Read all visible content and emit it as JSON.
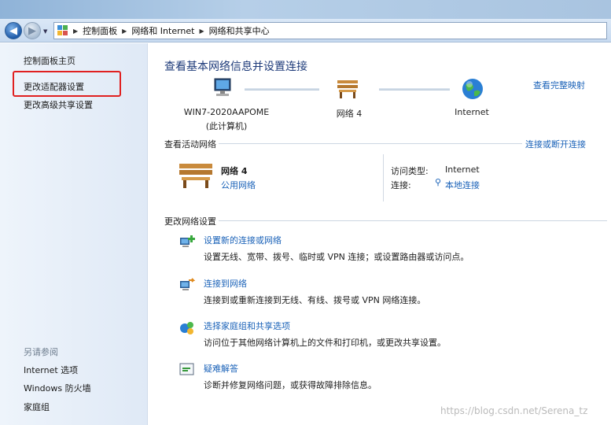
{
  "address_bar": {
    "breadcrumbs": [
      "控制面板",
      "网络和 Internet",
      "网络和共享中心"
    ]
  },
  "sidebar": {
    "home": "控制面板主页",
    "change_adapter": "更改适配器设置",
    "advanced_sharing": "更改高级共享设置",
    "see_also_title": "另请参阅",
    "see_also": [
      "Internet 选项",
      "Windows 防火墙",
      "家庭组"
    ]
  },
  "main": {
    "title": "查看基本网络信息并设置连接",
    "view_full_map": "查看完整映射",
    "map": {
      "computer_name": "WIN7-2020AAPOME",
      "computer_sub": "(此计算机)",
      "network": "网络  4",
      "internet": "Internet"
    },
    "active_header": "查看活动网络",
    "connect_disconnect": "连接或断开连接",
    "active_network": {
      "name": "网络  4",
      "type": "公用网络",
      "access_type_label": "访问类型:",
      "access_type_value": "Internet",
      "connection_label": "连接:",
      "connection_value": "本地连接"
    },
    "change_header": "更改网络设置",
    "tasks": [
      {
        "title": "设置新的连接或网络",
        "desc": "设置无线、宽带、拨号、临时或 VPN 连接；或设置路由器或访问点。"
      },
      {
        "title": "连接到网络",
        "desc": "连接到或重新连接到无线、有线、拨号或 VPN 网络连接。"
      },
      {
        "title": "选择家庭组和共享选项",
        "desc": "访问位于其他网络计算机上的文件和打印机，或更改共享设置。"
      },
      {
        "title": "疑难解答",
        "desc": "诊断并修复网络问题，或获得故障排除信息。"
      }
    ]
  },
  "watermark": "https://blog.csdn.net/Serena_tz",
  "colors": {
    "link": "#1a62b8",
    "title": "#1e3b7a",
    "highlight": "#e02020"
  }
}
